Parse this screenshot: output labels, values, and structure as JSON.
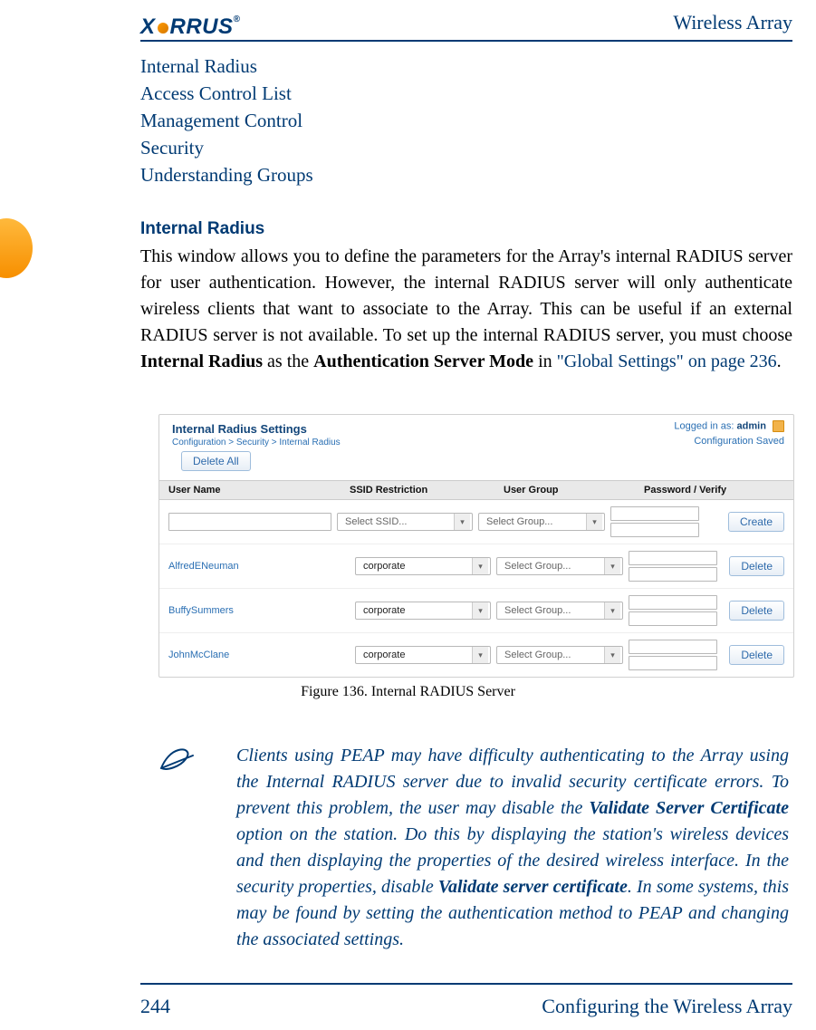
{
  "header": {
    "logo_text": "X",
    "logo_tail": "RRUS",
    "title": "Wireless Array"
  },
  "nav": [
    "Internal Radius",
    "Access Control List",
    "Management Control",
    "Security",
    "Understanding Groups"
  ],
  "section": {
    "heading": "Internal Radius"
  },
  "body": {
    "t1": "This window allows you to define the parameters for the Array's internal RADIUS server for user authentication. However, the internal RADIUS server will only authenticate wireless clients that want to associate to the Array. This can be useful if an external RADIUS server is not available. To set up the internal RADIUS server, you must choose ",
    "b1": "Internal Radius",
    "t2": " as the ",
    "b2": "Authentication Server Mode",
    "t3": " in ",
    "link": "\"Global Settings\" on page 236",
    "t4": "."
  },
  "figure": {
    "title": "Internal Radius Settings",
    "crumb": "Configuration > Security > Internal Radius",
    "login_prefix": "Logged in as: ",
    "login_user": "admin",
    "config_saved": "Configuration Saved",
    "delete_all": "Delete All",
    "headers": {
      "user": "User Name",
      "ssid": "SSID Restriction",
      "group": "User Group",
      "pw": "Password   /   Verify"
    },
    "placeholders": {
      "ssid": "Select SSID...",
      "group": "Select Group..."
    },
    "create": "Create",
    "delete": "Delete",
    "rows": [
      {
        "user": "AlfredENeuman",
        "ssid": "corporate",
        "group": "Select Group..."
      },
      {
        "user": "BuffySummers",
        "ssid": "corporate",
        "group": "Select Group..."
      },
      {
        "user": "JohnMcClane",
        "ssid": "corporate",
        "group": "Select Group..."
      }
    ],
    "caption": "Figure 136. Internal RADIUS Server"
  },
  "note": {
    "t1": "Clients using PEAP may have difficulty authenticating to the Array using the Internal RADIUS server due to invalid security certificate errors. To prevent this problem, the user may disable the ",
    "b1": "Validate Server Certificate",
    "t2": " option on the station. Do this by displaying the station's wireless devices and then displaying the properties of the desired wireless interface. In the security properties, disable ",
    "b2": "Validate server certificate",
    "t3": ". In some systems, this may be found by setting the authentication method to PEAP and changing the associated settings."
  },
  "footer": {
    "page": "244",
    "title": "Configuring the Wireless Array"
  }
}
